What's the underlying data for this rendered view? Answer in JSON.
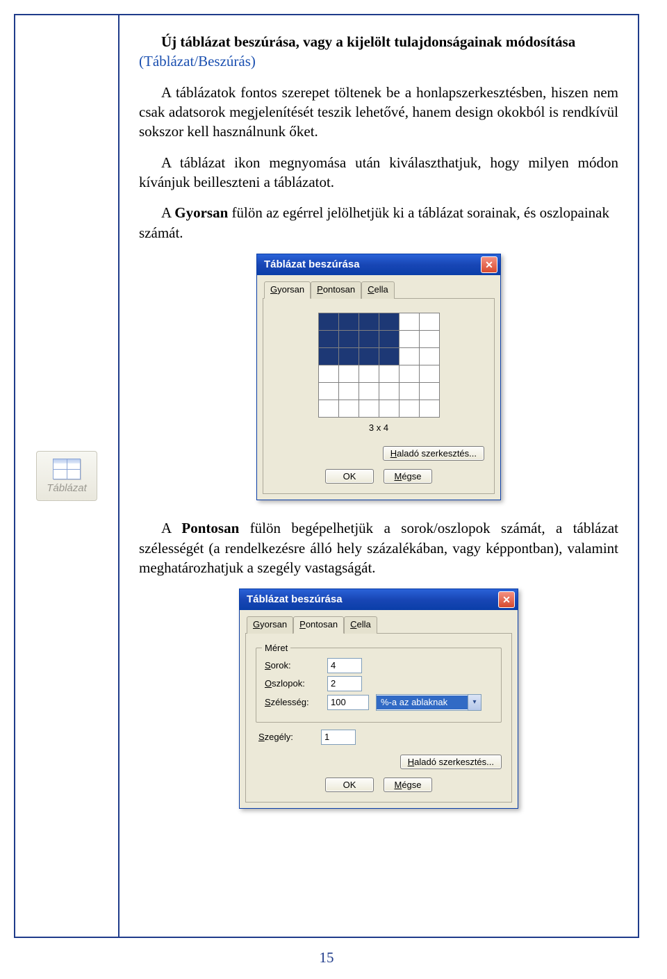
{
  "doc": {
    "title_bold": "Új táblázat beszúrása, vagy a kijelölt tulajdonságainak módosítása",
    "title_link": "(Táblázat/Beszúrás)",
    "para1": "A táblázatok fontos szerepet töltenek be a honlapszerkesztésben, hiszen nem csak adatsorok megjelenítését teszik lehetővé, hanem design okokból is rendkívül sokszor kell használnunk őket.",
    "para2": "A táblázat ikon megnyomása után kiválaszthatjuk, hogy milyen módon kívánjuk beilleszteni a táblázatot.",
    "para3_pre": "A ",
    "para3_bold": "Gyorsan",
    "para3_post": " fülön az egérrel jelölhetjük ki a táblázat sorainak, és oszlopainak számát.",
    "para4_pre": "A ",
    "para4_bold": "Pontosan",
    "para4_post": " fülön begépelhetjük a sorok/oszlopok számát, a táblázat szélességét (a rendelkezésre álló hely százalékában, vagy képpontban), valamint meghatározhatjuk a szegély vastagságát.",
    "page_number": "15"
  },
  "sidebar_button": {
    "label": "Táblázat"
  },
  "dialog1": {
    "title": "Táblázat beszúrása",
    "tabs": {
      "gyorsan": "Gyorsan",
      "pontosan": "Pontosan",
      "cella": "Cella"
    },
    "grid_caption": "3 x 4",
    "advanced": "Haladó szerkesztés...",
    "ok": "OK",
    "cancel": "Mégse"
  },
  "dialog2": {
    "title": "Táblázat beszúrása",
    "tabs": {
      "gyorsan": "Gyorsan",
      "pontosan": "Pontosan",
      "cella": "Cella"
    },
    "group_meret": "Méret",
    "lbl_sorok": "Sorok:",
    "val_sorok": "4",
    "lbl_oszlopok": "Oszlopok:",
    "val_oszlopok": "2",
    "lbl_szelesseg": "Szélesség:",
    "val_szelesseg": "100",
    "szelesseg_unit": "%-a az ablaknak",
    "lbl_szegely": "Szegély:",
    "val_szegely": "1",
    "advanced": "Haladó szerkesztés...",
    "ok": "OK",
    "cancel": "Mégse"
  }
}
